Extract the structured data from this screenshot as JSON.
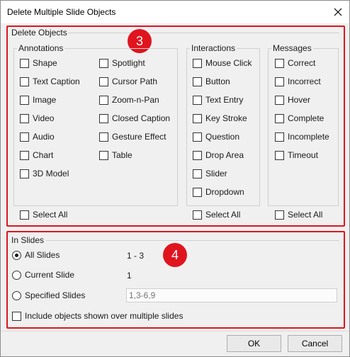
{
  "window": {
    "title": "Delete Multiple Slide Objects"
  },
  "badges": {
    "delete_objects": "3",
    "in_slides": "4"
  },
  "delete_objects": {
    "label": "Delete Objects",
    "annotations": {
      "label": "Annotations",
      "items_col1": [
        "Shape",
        "Text Caption",
        "Image",
        "Video",
        "Audio",
        "Chart",
        "3D Model"
      ],
      "items_col2": [
        "Spotlight",
        "Cursor Path",
        "Zoom-n-Pan",
        "Closed Caption",
        "Gesture Effect",
        "Table"
      ],
      "select_all": "Select All"
    },
    "interactions": {
      "label": "Interactions",
      "items": [
        "Mouse Click",
        "Button",
        "Text Entry",
        "Key Stroke",
        "Question",
        "Drop Area",
        "Slider",
        "Dropdown"
      ],
      "select_all": "Select All"
    },
    "messages": {
      "label": "Messages",
      "items": [
        "Correct",
        "Incorrect",
        "Hover",
        "Complete",
        "Incomplete",
        "Timeout"
      ],
      "select_all": "Select All"
    }
  },
  "in_slides": {
    "label": "In Slides",
    "all_slides": {
      "label": "All Slides",
      "value": "1 - 3",
      "selected": true
    },
    "current_slide": {
      "label": "Current Slide",
      "value": "1"
    },
    "specified_slides": {
      "label": "Specified Slides",
      "placeholder": "1,3-6,9"
    },
    "include_multi": "Include objects shown over multiple slides"
  },
  "buttons": {
    "ok": "OK",
    "cancel": "Cancel"
  },
  "colors": {
    "highlight": "#e0141e",
    "dialog_bg": "#f0f0f0"
  }
}
